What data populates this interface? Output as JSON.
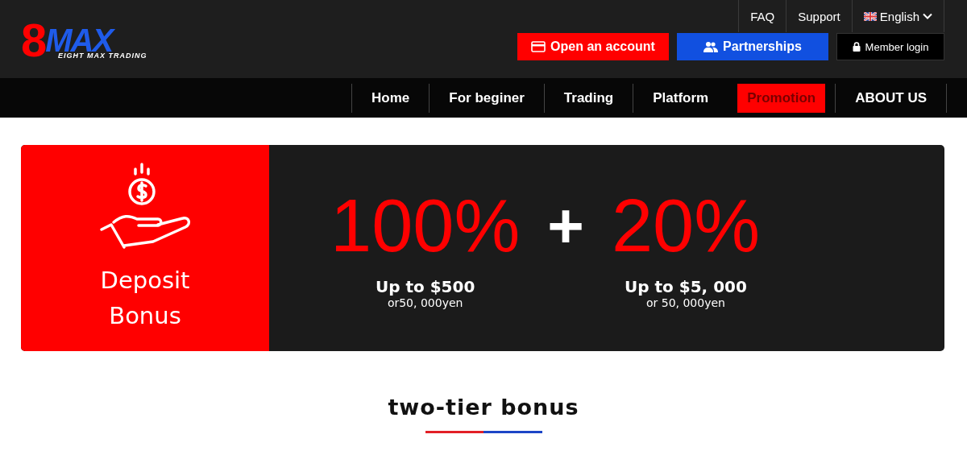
{
  "logo": {
    "mark": "8",
    "name": "MAX",
    "tagline": "EIGHT MAX TRADING"
  },
  "top_links": [
    {
      "label": "FAQ",
      "kind": "text"
    },
    {
      "label": "Support",
      "kind": "text"
    },
    {
      "label": "English",
      "kind": "language"
    }
  ],
  "action_buttons": [
    {
      "label": "Open an account",
      "kind": "account"
    },
    {
      "label": "Partnerships",
      "kind": "partner"
    },
    {
      "label": "Member login",
      "kind": "login"
    }
  ],
  "nav": [
    {
      "label": "Home",
      "selected": false
    },
    {
      "label": "For beginer",
      "selected": false
    },
    {
      "label": "Trading",
      "selected": false
    },
    {
      "label": "Platform",
      "selected": false
    },
    {
      "label": "Promotion",
      "selected": true
    },
    {
      "label": "ABOUT US",
      "selected": false
    }
  ],
  "banner": {
    "title": "Deposit Bonus",
    "operator": "+",
    "offers": [
      {
        "percent": "100%",
        "limit": "Up to $500",
        "alternative": "or50, 000yen"
      },
      {
        "percent": "20%",
        "limit": "Up to $5, 000",
        "alternative": "or 50, 000yen"
      }
    ]
  },
  "section_title": "two-tier bonus"
}
